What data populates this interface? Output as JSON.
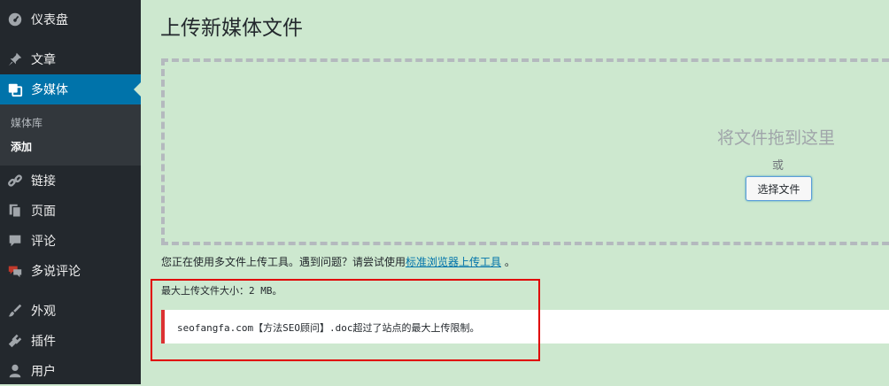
{
  "sidebar": {
    "items": [
      {
        "label": "仪表盘",
        "icon": "dashboard-icon"
      },
      {
        "label": "文章",
        "icon": "pin-icon"
      },
      {
        "label": "多媒体",
        "icon": "media-icon"
      },
      {
        "label": "链接",
        "icon": "link-icon"
      },
      {
        "label": "页面",
        "icon": "pages-icon"
      },
      {
        "label": "评论",
        "icon": "comment-icon"
      },
      {
        "label": "多说评论",
        "icon": "duoshuo-icon"
      },
      {
        "label": "外观",
        "icon": "brush-icon"
      },
      {
        "label": "插件",
        "icon": "plugin-icon"
      },
      {
        "label": "用户",
        "icon": "user-icon"
      }
    ],
    "submenu": [
      "媒体库",
      "添加"
    ]
  },
  "main": {
    "title": "上传新媒体文件",
    "drop_text": "将文件拖到这里",
    "or_text": "或",
    "select_button": "选择文件",
    "uploader_note_prefix": "您正在使用多文件上传工具。遇到问题？请尝试使用",
    "uploader_note_link": "标准浏览器上传工具",
    "uploader_note_suffix": " 。",
    "max_size": "最大上传文件大小：2 MB。",
    "error_message": "seofangfa.com【方法SEO顾问】.doc超过了站点的最大上传限制。"
  },
  "colors": {
    "sidebar_bg": "#23282d",
    "active_bg": "#0073aa",
    "content_bg": "#cde8cf",
    "error_border": "#dc3232",
    "highlight": "#e00000",
    "link": "#0073aa"
  }
}
